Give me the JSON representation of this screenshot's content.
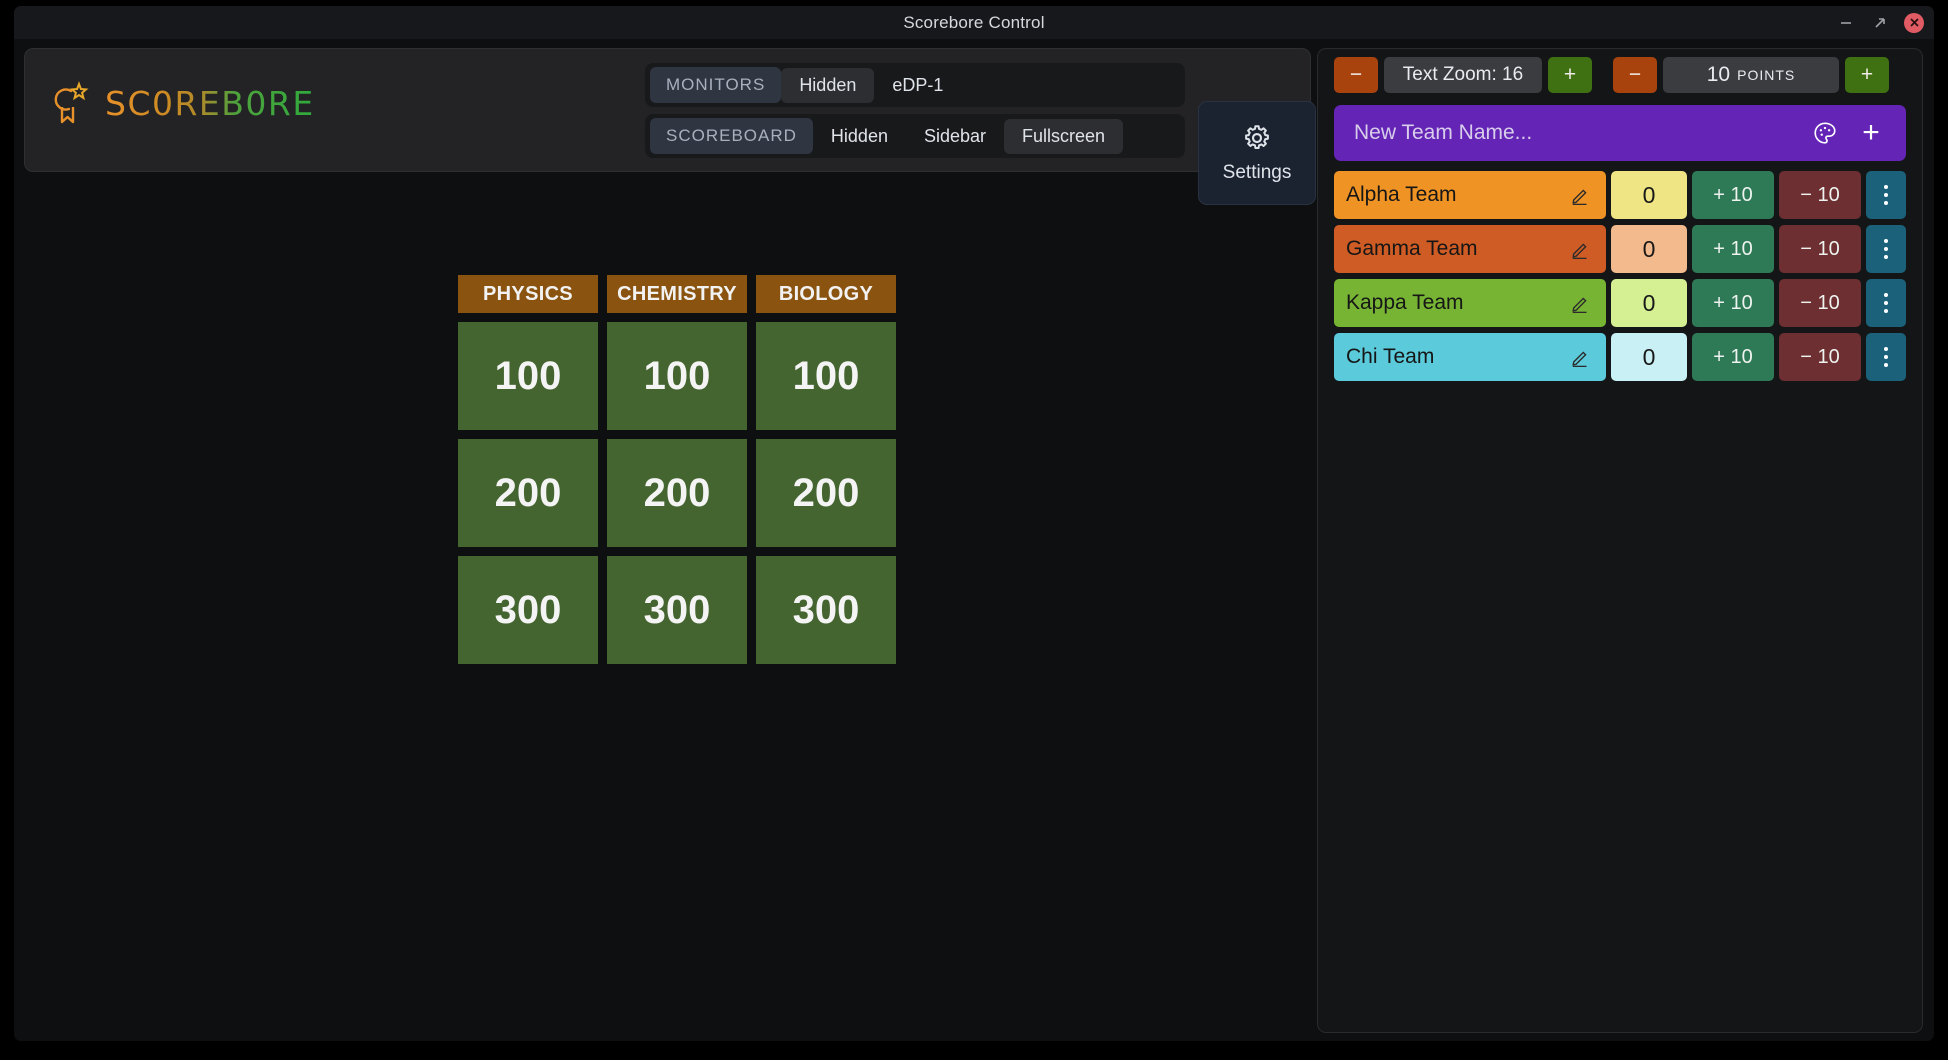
{
  "window": {
    "title": "Scorebore Control",
    "controls": {
      "minimize": "minimize-icon",
      "maximize": "maximize-icon",
      "close": "close-icon"
    }
  },
  "header": {
    "logo_text": "SC0REB0RE",
    "logo_icon": "medal-star-icon",
    "monitors": {
      "label": "MONITORS",
      "options": [
        "Hidden",
        "eDP-1"
      ],
      "selected": "Hidden"
    },
    "scoreboard": {
      "label": "SCOREBOARD",
      "options": [
        "Hidden",
        "Sidebar",
        "Fullscreen"
      ],
      "selected": "Fullscreen"
    },
    "settings": {
      "label": "Settings",
      "icon": "gear-icon"
    }
  },
  "board": {
    "categories": [
      "PHYSICS",
      "CHEMISTRY",
      "BIOLOGY"
    ],
    "rows": [
      [
        "100",
        "100",
        "100"
      ],
      [
        "200",
        "200",
        "200"
      ],
      [
        "300",
        "300",
        "300"
      ]
    ],
    "colors": {
      "category_bg": "#8a5410",
      "value_bg": "#456530"
    }
  },
  "panel": {
    "text_zoom": {
      "label": "Text Zoom: 16",
      "minus": "−",
      "plus": "+"
    },
    "points": {
      "amount": "10",
      "word": "POINTS",
      "minus": "−",
      "plus": "+"
    },
    "new_team": {
      "placeholder": "New Team Name...",
      "value": "",
      "palette_icon": "color-palette-icon",
      "add_icon": "plus-icon"
    },
    "row_actions": {
      "plus_label": "+ 10",
      "minus_label": "− 10",
      "edit_icon": "pencil-icon",
      "menu_icon": "kebab-menu-icon"
    },
    "teams": [
      {
        "name": "Alpha Team",
        "score": "0",
        "color": "#ef9324",
        "score_color": "#efe585"
      },
      {
        "name": "Gamma Team",
        "score": "0",
        "color": "#cf5c25",
        "score_color": "#f3ba8d"
      },
      {
        "name": "Kappa Team",
        "score": "0",
        "color": "#77b434",
        "score_color": "#d4f093"
      },
      {
        "name": "Chi Team",
        "score": "0",
        "color": "#5bcada",
        "score_color": "#c9f1f5"
      }
    ]
  }
}
